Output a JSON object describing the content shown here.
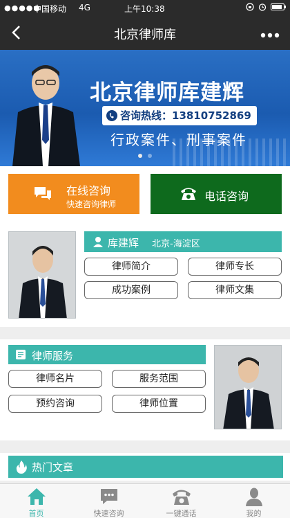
{
  "status_bar": {
    "signal": "●●●●●",
    "carrier": "中国移动",
    "network": "4G",
    "time": "上午10:38"
  },
  "nav": {
    "back_icon": "chevron-left-icon",
    "back_glyph": "<",
    "title": "北京律师库",
    "more_icon": "more-dots-icon",
    "more_glyph": "•••"
  },
  "banner": {
    "headline": "北京律师库建辉",
    "hotline": "咨询热线：13810752869",
    "tagline": "行政案件、刑事案件",
    "carousel_active_index": 0,
    "carousel_count": 2
  },
  "consult": {
    "online_title": "在线咨询",
    "online_sub": "快速咨询律师",
    "online_icon": "chat-bubble-icon",
    "phone_title": "电话咨询",
    "phone_icon": "telephone-icon"
  },
  "lawyer": {
    "name": "库建辉",
    "location": "北京-海淀区",
    "icon": "person-icon",
    "buttons": [
      "律师简介",
      "律师专长",
      "成功案例",
      "律师文集"
    ]
  },
  "service": {
    "title": "律师服务",
    "icon": "service-book-icon",
    "buttons": [
      "律师名片",
      "服务范围",
      "预约咨询",
      "律师位置"
    ]
  },
  "hot": {
    "title": "热门文章",
    "icon": "flame-icon"
  },
  "tabs": [
    {
      "label": "首页",
      "icon": "home-icon",
      "active": true
    },
    {
      "label": "快速咨询",
      "icon": "chat-icon",
      "active": false
    },
    {
      "label": "一键通话",
      "icon": "phone-icon",
      "active": false
    },
    {
      "label": "我的",
      "icon": "user-icon",
      "active": false
    }
  ],
  "colors": {
    "teal": "#3cb6ac",
    "orange": "#f28c1e",
    "green": "#0e6a1d",
    "tab_active": "#3cb6ac",
    "tab_inactive": "#888888"
  }
}
